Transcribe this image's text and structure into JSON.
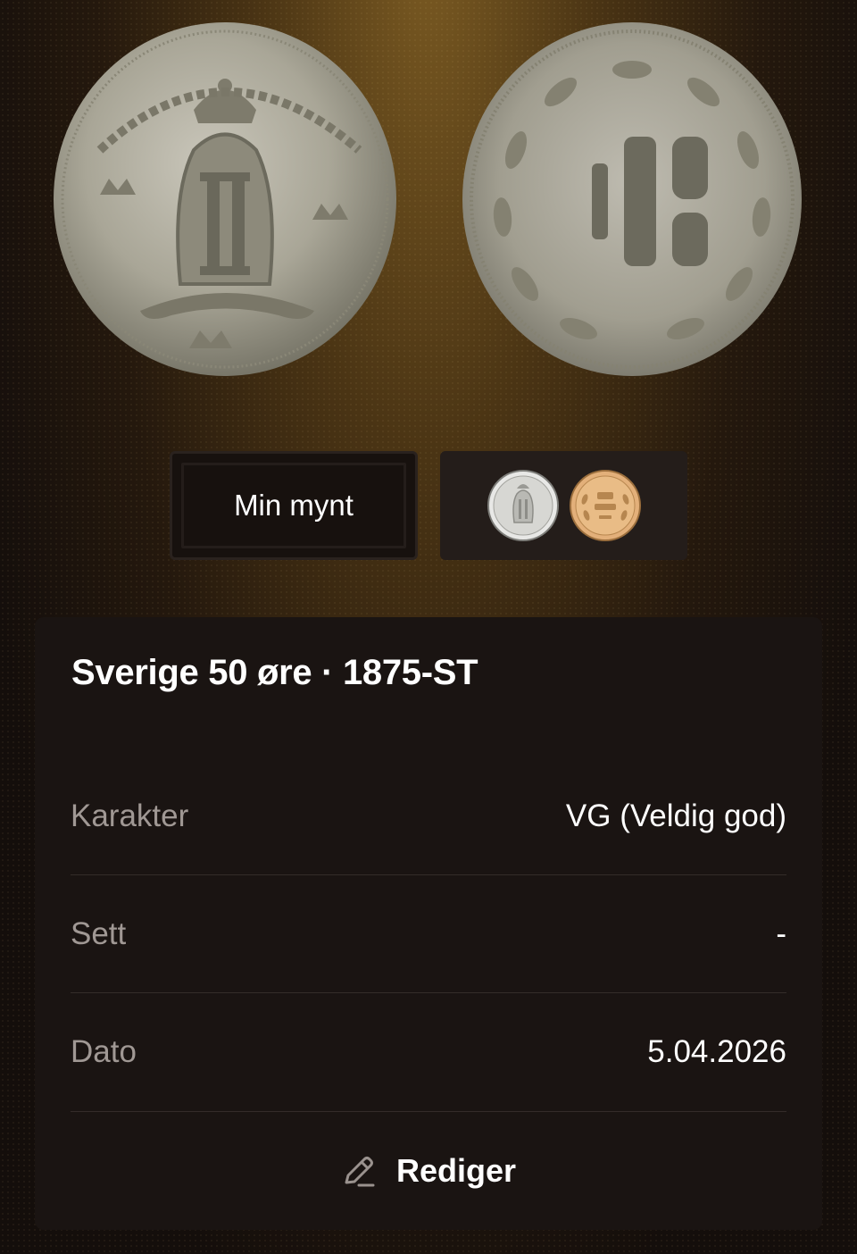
{
  "tabs": {
    "my_coin_label": "Min mynt"
  },
  "coin": {
    "title": "Sverige 50 øre · 1875-ST",
    "details": [
      {
        "label": "Karakter",
        "value": "VG (Veldig god)"
      },
      {
        "label": "Sett",
        "value": "-"
      },
      {
        "label": "Dato",
        "value": "5.04.2026"
      }
    ]
  },
  "actions": {
    "edit_label": "Rediger",
    "edit_icon": "pencil-icon"
  },
  "colors": {
    "background": "#130e0b",
    "card": "#1a1412",
    "label_gray": "#a09894",
    "silver": "#b8b4a8",
    "gold_reference": "#d9a866"
  }
}
